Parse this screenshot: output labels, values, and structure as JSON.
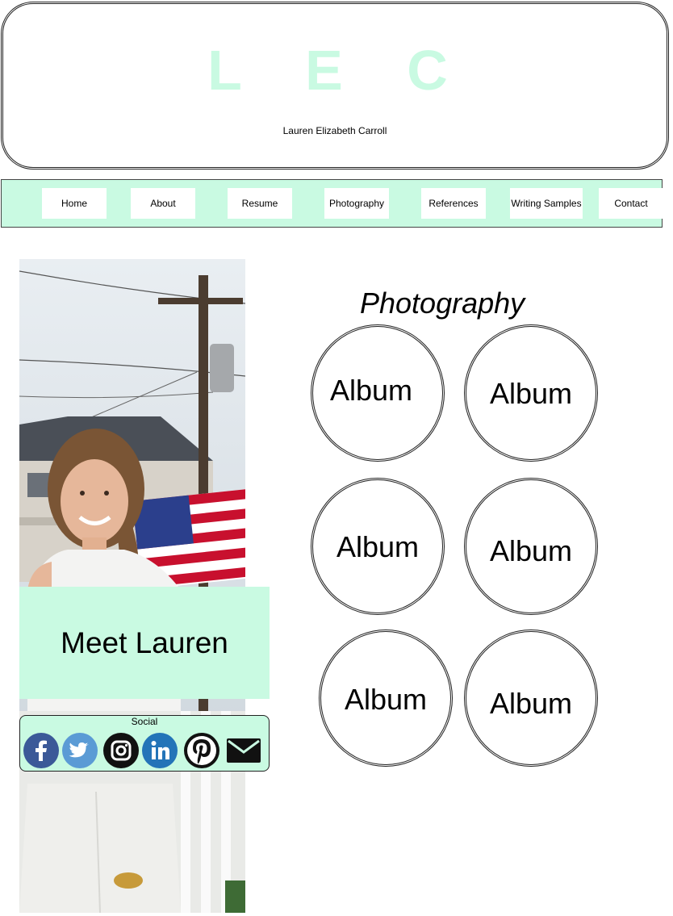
{
  "header": {
    "logo": "L E C",
    "subtitle": "Lauren Elizabeth Carroll"
  },
  "nav": {
    "items": [
      {
        "label": "Home"
      },
      {
        "label": "About"
      },
      {
        "label": "Resume"
      },
      {
        "label": "Photography"
      },
      {
        "label": "References"
      },
      {
        "label": "Writing Samples"
      },
      {
        "label": "Contact"
      }
    ]
  },
  "sidebar": {
    "meet_label": "Meet Lauren",
    "social_label": "Social",
    "social_icons": [
      "facebook-icon",
      "twitter-icon",
      "instagram-icon",
      "linkedin-icon",
      "pinterest-icon",
      "email-icon"
    ]
  },
  "main": {
    "title": "Photography",
    "albums": [
      {
        "label": "Album"
      },
      {
        "label": "Album"
      },
      {
        "label": "Album"
      },
      {
        "label": "Album"
      },
      {
        "label": "Album"
      },
      {
        "label": "Album"
      }
    ]
  },
  "colors": {
    "accent": "#c9fae2",
    "facebook": "#3b5998",
    "twitter": "#5b9bd5",
    "linkedin": "#2374b8"
  }
}
